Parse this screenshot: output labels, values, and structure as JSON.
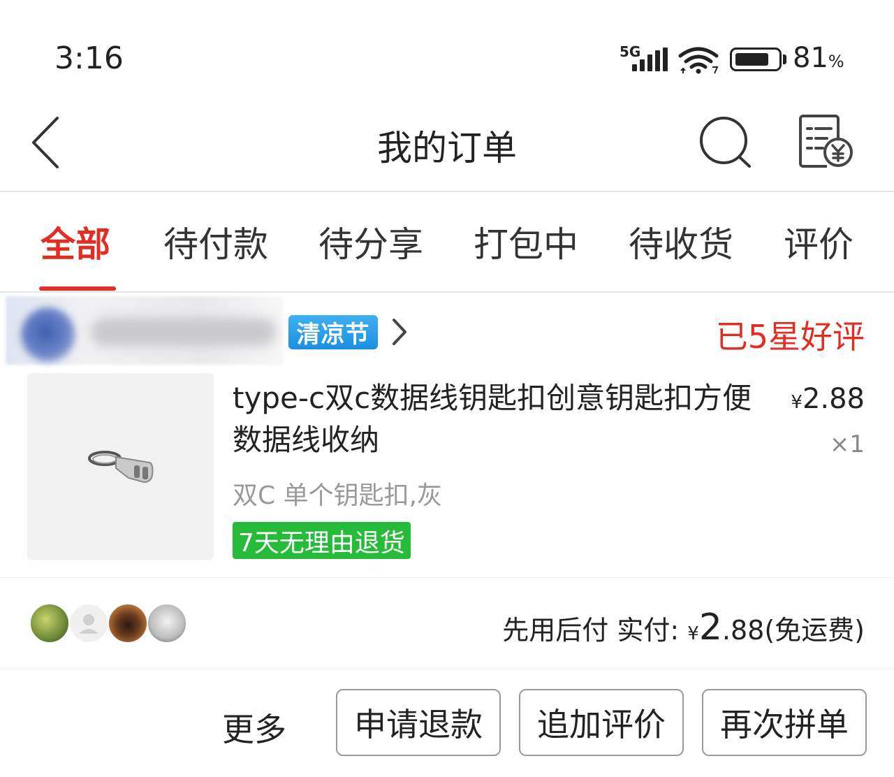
{
  "status_bar": {
    "time": "3:16",
    "network": "5G",
    "battery_pct": "81",
    "battery_unit": "%",
    "battery_level": 0.81
  },
  "header": {
    "title": "我的订单",
    "back_icon": "back-chevron-icon",
    "search_icon": "search-icon",
    "bill_icon": "bill-yen-icon"
  },
  "tabs": [
    {
      "label": "全部",
      "active": true
    },
    {
      "label": "待付款",
      "active": false
    },
    {
      "label": "待分享",
      "active": false
    },
    {
      "label": "打包中",
      "active": false
    },
    {
      "label": "待收货",
      "active": false
    },
    {
      "label": "评价",
      "active": false
    }
  ],
  "order": {
    "store_badge": "清凉节",
    "status": "已5星好评",
    "product_title": "type-c双c数据线钥匙扣创意钥匙扣方便数据线收纳",
    "price_symbol": "¥",
    "price": "2.88",
    "quantity": "×1",
    "spec": "双C 单个钥匙扣,灰",
    "return_tag": "7天无理由退货",
    "summary_prefix": "先用后付 实付: ",
    "summary_yen": "¥",
    "summary_amount_int": "2",
    "summary_amount_dec": ".88",
    "summary_suffix": "(免运费)"
  },
  "actions": {
    "more": "更多",
    "refund": "申请退款",
    "add_review": "追加评价",
    "reorder": "再次拼单"
  },
  "colors": {
    "accent_red": "#e02e24",
    "tag_green": "#27bb3a",
    "badge_blue": "#1b8fe0"
  }
}
